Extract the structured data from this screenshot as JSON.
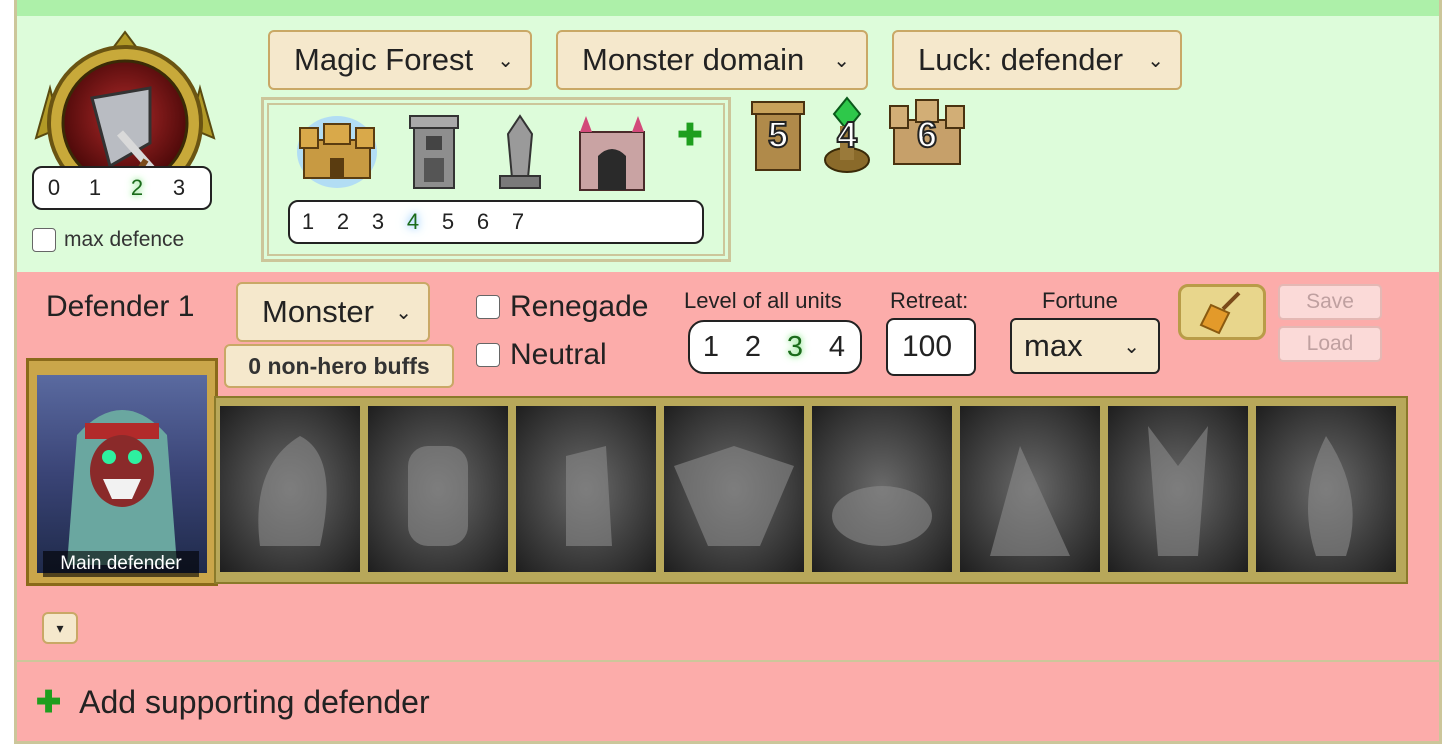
{
  "location": {
    "terrain_select": "Magic Forest",
    "domain_select": "Monster domain",
    "luck_select": "Luck: defender"
  },
  "attack_defense": {
    "levels": [
      "0",
      "1",
      "2",
      "3"
    ],
    "selected_level": "2",
    "max_defence_label": "max defence"
  },
  "fortifications": {
    "levels": [
      "1",
      "2",
      "3",
      "4",
      "5",
      "6",
      "7"
    ],
    "selected_level": "4",
    "buildings": [
      {
        "icon": "castle-icon",
        "selected": true
      },
      {
        "icon": "tower-icon",
        "selected": false
      },
      {
        "icon": "obelisk-icon",
        "selected": false
      },
      {
        "icon": "gate-icon",
        "selected": false
      }
    ],
    "add_icon": "plus-icon",
    "badges": [
      {
        "icon": "tower-badge-icon",
        "value": "5"
      },
      {
        "icon": "crystal-badge-icon",
        "value": "4"
      },
      {
        "icon": "castle-badge-icon",
        "value": "6"
      }
    ]
  },
  "defender": {
    "title": "Defender 1",
    "faction_select": "Monster",
    "buffs_button": "0 non-hero buffs",
    "renegade_label": "Renegade",
    "neutral_label": "Neutral",
    "level_label": "Level of all units",
    "levels": [
      "1",
      "2",
      "3",
      "4"
    ],
    "selected_level": "3",
    "retreat_label": "Retreat:",
    "retreat_value": "100",
    "fortune_label": "Fortune",
    "fortune_value": "max",
    "save_label": "Save",
    "load_label": "Load",
    "main_defender_label": "Main defender",
    "expand_glyph": "▾"
  },
  "footer": {
    "add_supporting_label": "Add supporting defender"
  },
  "colors": {
    "green_bg": "#ddfcda",
    "red_bg": "#fcacaa",
    "gold_border": "#ccc69a",
    "dropdown_bg": "#f5e8cc"
  }
}
